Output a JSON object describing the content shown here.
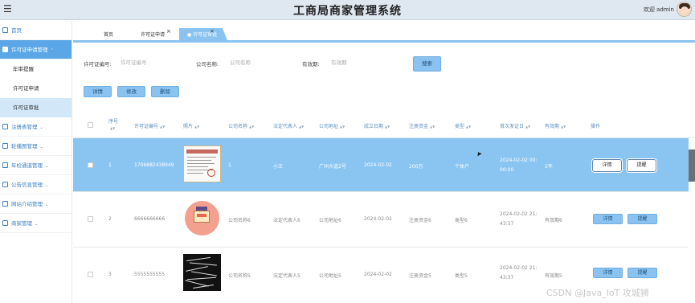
{
  "header": {
    "title": "工商局商家管理系统",
    "welcome": "欢迎 admin"
  },
  "sidebar": {
    "items": [
      {
        "label": "首页",
        "icon": "home-icon"
      },
      {
        "label": "许可证申请管理",
        "icon": "folder-icon",
        "expanded": true,
        "children": [
          "年审提醒",
          "许可证申请",
          "许可证审批"
        ]
      },
      {
        "label": "注册表管理",
        "icon": "info-icon"
      },
      {
        "label": "轮播图管理",
        "icon": "image-icon"
      },
      {
        "label": "年检通道管理",
        "icon": "target-icon"
      },
      {
        "label": "公告信息管理",
        "icon": "document-icon"
      },
      {
        "label": "网站介绍管理",
        "icon": "grid-icon"
      },
      {
        "label": "商家管理",
        "icon": "user-icon"
      }
    ]
  },
  "tabs": [
    "首页",
    "许可证申请",
    "许可证审批"
  ],
  "search": {
    "license_label": "许可证编号:",
    "license_placeholder": "许可证编号",
    "company_label": "公司名称:",
    "company_placeholder": "公司名称",
    "validity_label": "有效期:",
    "validity_placeholder": "有效期",
    "search_button": "搜索"
  },
  "toolbar": {
    "detail": "详情",
    "edit": "修改",
    "delete": "删除"
  },
  "table": {
    "columns": [
      "序号",
      "许可证编号",
      "照片",
      "公司名称",
      "法定代表人",
      "公司地址",
      "成立日期",
      "注册资金",
      "类型",
      "首次发证日",
      "有效期",
      "操作"
    ],
    "rows": [
      {
        "no": "1",
        "license": "1706882438949",
        "company": "1",
        "rep": "小王",
        "address": "广州大道2号",
        "date": "2024-02-02",
        "capital": "200万",
        "type": "个体户",
        "issue_line1": "2024-02-02 00:",
        "issue_line2": "00:00",
        "validity": "2年"
      },
      {
        "no": "2",
        "license": "6666666666",
        "company": "公司名称6",
        "rep": "法定代表人6",
        "address": "公司地址6",
        "date": "2024-02-02",
        "capital": "注册资金6",
        "type": "类型6",
        "issue_line1": "2024-02-02 21:",
        "issue_line2": "43:37",
        "validity": "有效期6"
      },
      {
        "no": "3",
        "license": "5555555555",
        "company": "公司名称5",
        "rep": "法定代表人5",
        "address": "公司地址5",
        "date": "2024-02-02",
        "capital": "注册资金5",
        "type": "类型5",
        "issue_line1": "2024-02-02 21:",
        "issue_line2": "43:37",
        "validity": "有效期5"
      }
    ],
    "row_detail": "详情",
    "row_remind": "提醒"
  },
  "watermark": "CSDN @Java_IoT 攻城狮",
  "colors": {
    "accent": "#8ac3f0",
    "selected_row": "#8ac5f2",
    "sidebar_active": "#5aa6e6",
    "header_bg": "#dfe7f1"
  }
}
